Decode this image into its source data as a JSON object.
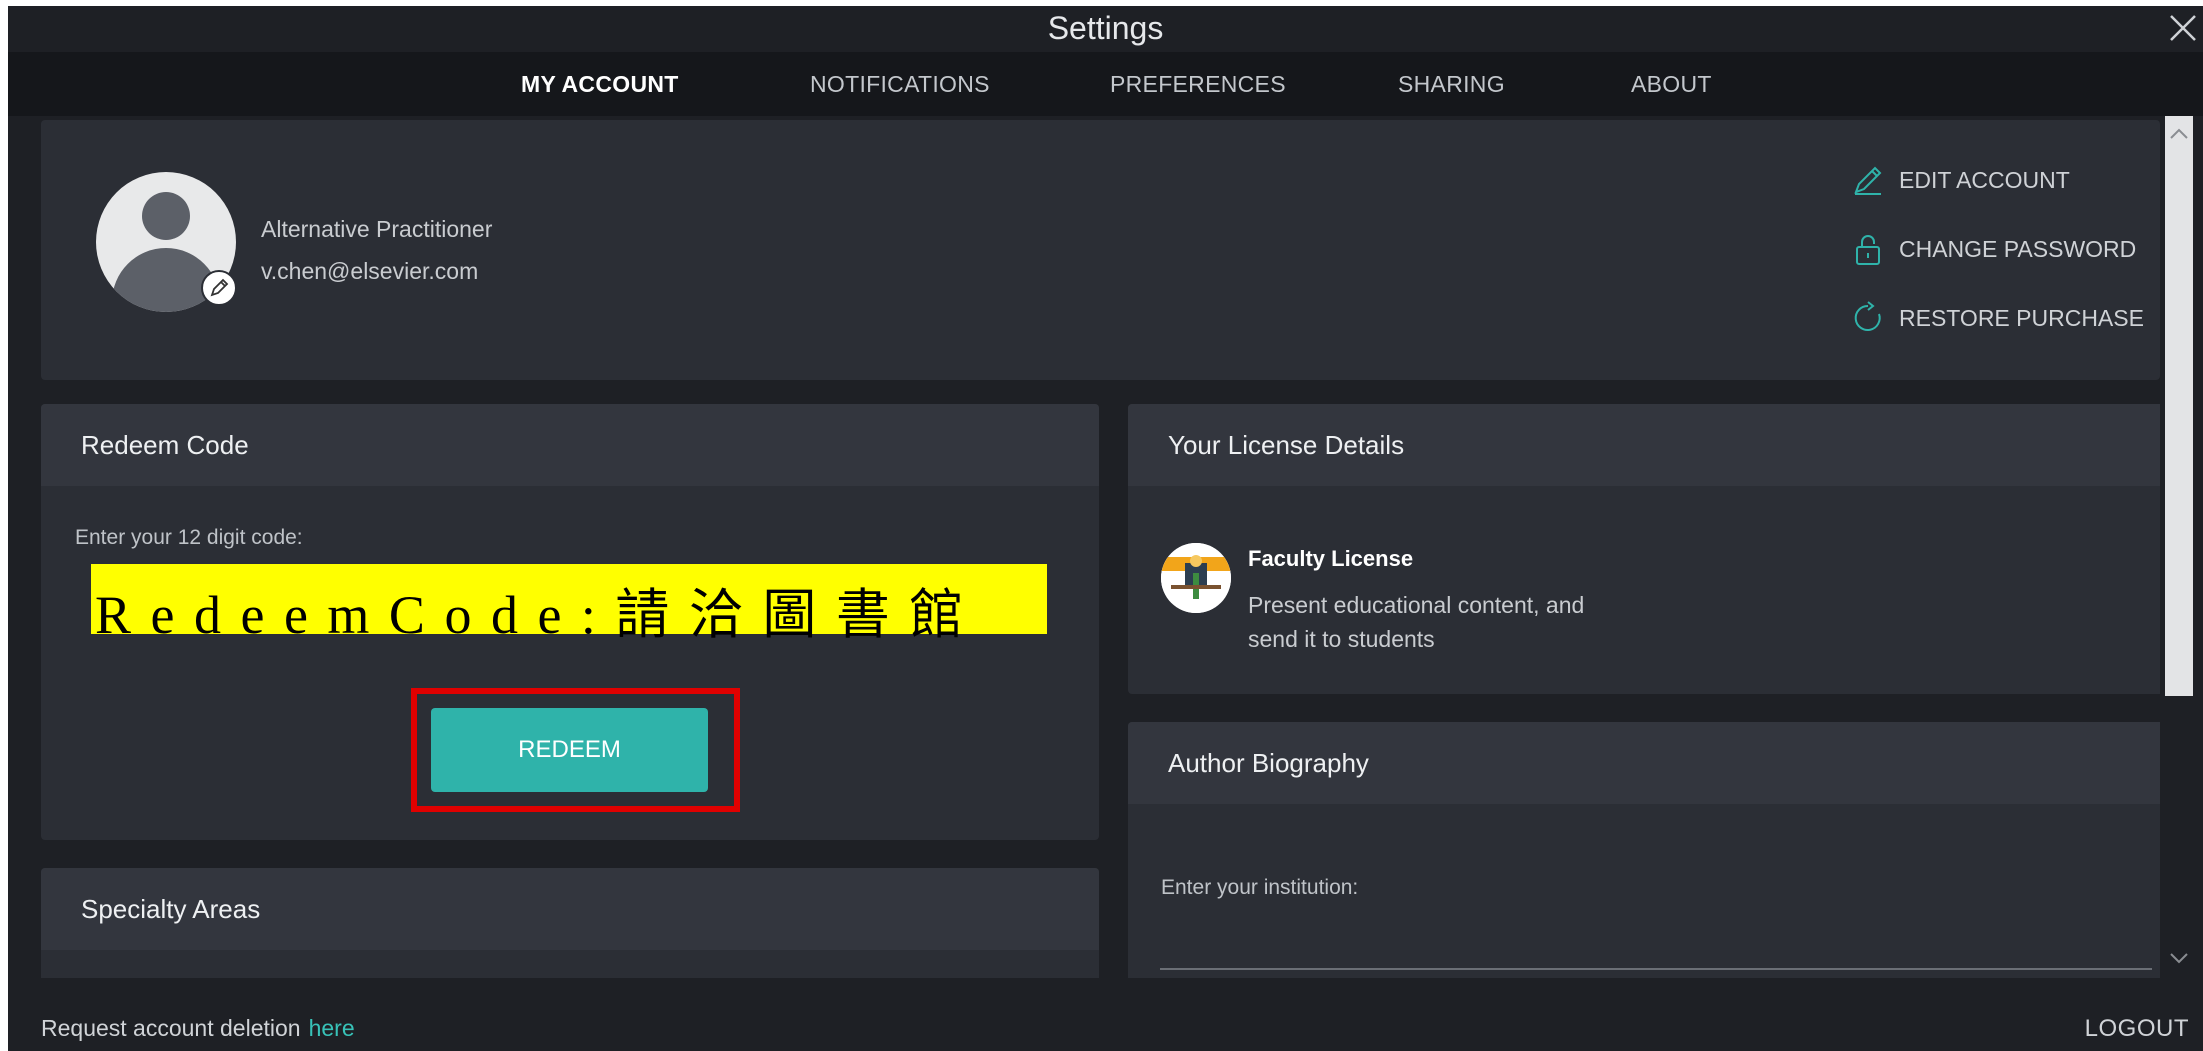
{
  "window": {
    "title": "Settings"
  },
  "tabs": [
    {
      "label": "MY ACCOUNT",
      "active": true
    },
    {
      "label": "NOTIFICATIONS",
      "active": false
    },
    {
      "label": "PREFERENCES",
      "active": false
    },
    {
      "label": "SHARING",
      "active": false
    },
    {
      "label": "ABOUT",
      "active": false
    }
  ],
  "profile": {
    "name": "Alternative Practitioner",
    "email": "v.chen@elsevier.com"
  },
  "account_actions": {
    "edit": "EDIT ACCOUNT",
    "change_password": "CHANGE PASSWORD",
    "restore_purchase": "RESTORE PURCHASE"
  },
  "redeem": {
    "header": "Redeem Code",
    "label": "Enter your 12 digit code:",
    "code_value": "R e d e e m  C o d e : 請 洽 圖 書 館",
    "button": "REDEEM"
  },
  "specialty": {
    "header": "Specialty Areas"
  },
  "license": {
    "header": "Your License Details",
    "title": "Faculty License",
    "description": "Present educational content, and send it to students"
  },
  "author_bio": {
    "header": "Author Biography",
    "institution_label": "Enter your institution:"
  },
  "footer": {
    "deletion_text": "Request account deletion",
    "deletion_link": "here",
    "logout": "LOGOUT"
  },
  "colors": {
    "accent": "#2fb3aa",
    "link": "#38c2b8",
    "panel": "#2b2e35",
    "panel_header": "#33363e",
    "background": "#1e2025",
    "highlight": "#ffff00",
    "annotation_frame": "#e00000"
  },
  "icons": {
    "close": "close-icon",
    "edit": "pencil-icon",
    "lock": "lock-icon",
    "restore": "refresh-icon",
    "avatar_edit": "pencil-icon"
  }
}
